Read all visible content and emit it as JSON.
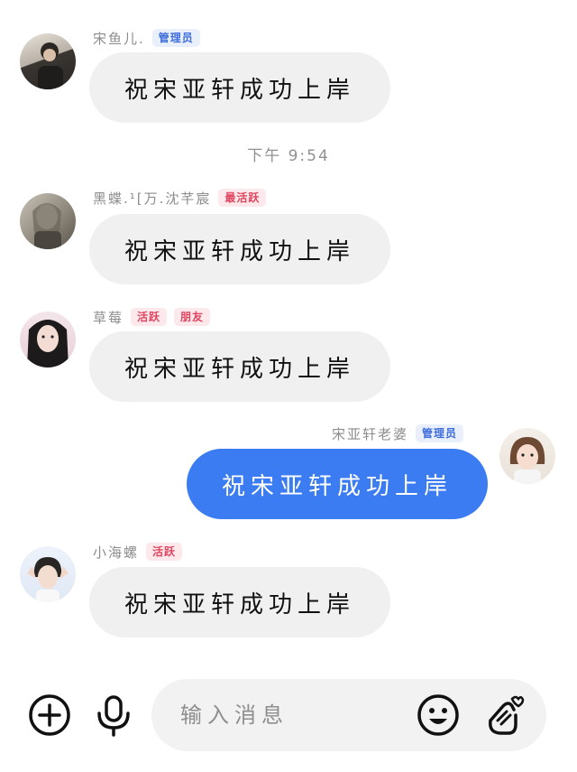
{
  "messages": [
    {
      "name": "宋鱼儿.",
      "badges": [
        "管理员"
      ],
      "text": "祝宋亚轩成功上岸"
    },
    {
      "name": "黑蝶.¹[万.沈芊宸",
      "badges": [
        "最活跃"
      ],
      "text": "祝宋亚轩成功上岸"
    },
    {
      "name": "草莓",
      "badges": [
        "活跃",
        "朋友"
      ],
      "text": "祝宋亚轩成功上岸"
    },
    {
      "name": "宋亚轩老婆",
      "badges": [
        "管理员"
      ],
      "text": "祝宋亚轩成功上岸"
    },
    {
      "name": "小海螺",
      "badges": [
        "活跃"
      ],
      "text": "祝宋亚轩成功上岸"
    }
  ],
  "timestamp": "下午 9:54",
  "composer": {
    "placeholder": "输入消息",
    "icons": [
      "plus-circle-icon",
      "microphone-icon",
      "emoji-icon",
      "finger-heart-icon"
    ]
  },
  "colors": {
    "outgoing_bubble": "#3b7cf2",
    "incoming_bubble": "#f0f0f0",
    "admin_badge_text": "#3f6fdc",
    "hot_badge_text": "#e0445e"
  }
}
